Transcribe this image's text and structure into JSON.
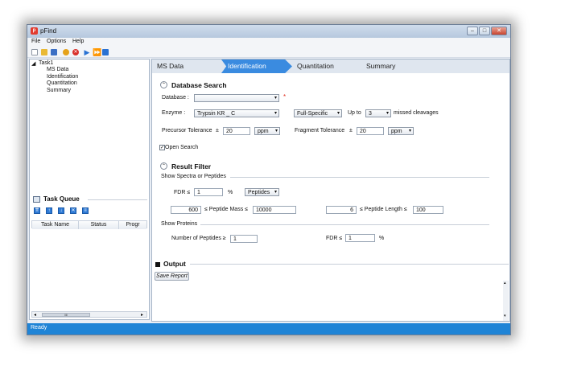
{
  "window": {
    "title": "pFind",
    "logo_letter": "p"
  },
  "menu": [
    "File",
    "Options",
    "Help"
  ],
  "tree": {
    "root": "Task1",
    "children": [
      "MS Data",
      "Identification",
      "Quantitation",
      "Summary"
    ]
  },
  "task_queue": {
    "title": "Task Queue",
    "columns": [
      "Task Name",
      "Status",
      "Progr"
    ],
    "scroll_thumb": "III"
  },
  "tabs": [
    "MS Data",
    "Identification",
    "Quantitation",
    "Summary"
  ],
  "database_search": {
    "title": "Database Search",
    "database_label": "Database :",
    "database_value": "",
    "required_mark": "*",
    "enzyme_label": "Enzyme :",
    "enzyme_value": "Trypsin KR _ C",
    "specificity_value": "Full-Specific",
    "up_to_label": "Up to",
    "missed_value": "3",
    "missed_label": "missed cleavages",
    "precursor_label": "Precursor Tolerance",
    "precursor_pm": "±",
    "precursor_value": "20",
    "precursor_unit": "ppm",
    "fragment_label": "Fragment Tolerance",
    "fragment_pm": "±",
    "fragment_value": "20",
    "fragment_unit": "ppm",
    "open_search_label": "Open Search",
    "open_search_checked": true
  },
  "result_filter": {
    "title": "Result Filter",
    "spectra_group": "Show Spectra or Peptides",
    "fdr_label": "FDR ≤",
    "fdr_value": "1",
    "fdr_unit": "%",
    "fdr_level": "Peptides",
    "mass_min": "600",
    "mass_label": "≤ Peptide Mass ≤",
    "mass_max": "10000",
    "length_min": "6",
    "length_label": "≤ Peptide Length ≤",
    "length_max": "100",
    "proteins_group": "Show Proteins",
    "num_peptides_label": "Number of Peptides ≥",
    "num_peptides_value": "1",
    "protein_fdr_label": "FDR ≤",
    "protein_fdr_value": "1",
    "protein_fdr_unit": "%"
  },
  "output": {
    "title": "Output",
    "save_button": "Save Report"
  },
  "status": {
    "text": "Ready"
  },
  "colors": {
    "accent": "#3a8be0",
    "status_bar": "#1f84d6",
    "required": "#e03020"
  }
}
